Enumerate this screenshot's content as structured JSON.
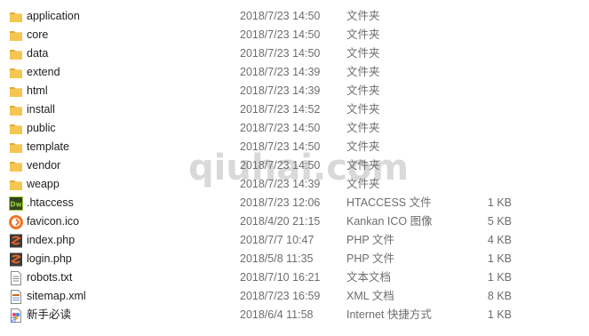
{
  "files": [
    {
      "name": "application",
      "date": "2018/7/23 14:50",
      "type": "文件夹",
      "size": "",
      "icon": "folder-icon"
    },
    {
      "name": "core",
      "date": "2018/7/23 14:50",
      "type": "文件夹",
      "size": "",
      "icon": "folder-icon"
    },
    {
      "name": "data",
      "date": "2018/7/23 14:50",
      "type": "文件夹",
      "size": "",
      "icon": "folder-icon"
    },
    {
      "name": "extend",
      "date": "2018/7/23 14:39",
      "type": "文件夹",
      "size": "",
      "icon": "folder-icon"
    },
    {
      "name": "html",
      "date": "2018/7/23 14:39",
      "type": "文件夹",
      "size": "",
      "icon": "folder-icon"
    },
    {
      "name": "install",
      "date": "2018/7/23 14:52",
      "type": "文件夹",
      "size": "",
      "icon": "folder-icon"
    },
    {
      "name": "public",
      "date": "2018/7/23 14:50",
      "type": "文件夹",
      "size": "",
      "icon": "folder-icon"
    },
    {
      "name": "template",
      "date": "2018/7/23 14:50",
      "type": "文件夹",
      "size": "",
      "icon": "folder-icon"
    },
    {
      "name": "vendor",
      "date": "2018/7/23 14:50",
      "type": "文件夹",
      "size": "",
      "icon": "folder-icon"
    },
    {
      "name": "weapp",
      "date": "2018/7/23 14:39",
      "type": "文件夹",
      "size": "",
      "icon": "folder-icon"
    },
    {
      "name": ".htaccess",
      "date": "2018/7/23 12:06",
      "type": "HTACCESS 文件",
      "size": "1 KB",
      "icon": "dreamweaver-file-icon"
    },
    {
      "name": "favicon.ico",
      "date": "2018/4/20 21:15",
      "type": "Kankan ICO 图像",
      "size": "5 KB",
      "icon": "ico-image-icon"
    },
    {
      "name": "index.php",
      "date": "2018/7/7 10:47",
      "type": "PHP 文件",
      "size": "4 KB",
      "icon": "php-file-icon"
    },
    {
      "name": "login.php",
      "date": "2018/5/8 11:35",
      "type": "PHP 文件",
      "size": "1 KB",
      "icon": "php-file-icon"
    },
    {
      "name": "robots.txt",
      "date": "2018/7/10 16:21",
      "type": "文本文档",
      "size": "1 KB",
      "icon": "text-file-icon"
    },
    {
      "name": "sitemap.xml",
      "date": "2018/7/23 16:59",
      "type": "XML 文档",
      "size": "8 KB",
      "icon": "xml-file-icon"
    },
    {
      "name": "新手必读",
      "date": "2018/6/4 11:58",
      "type": "Internet 快捷方式",
      "size": "1 KB",
      "icon": "internet-shortcut-icon"
    }
  ],
  "watermark": "qiuhai.com",
  "colors": {
    "folder": "#f5c650",
    "folder_dark": "#e2a93a",
    "dreamweaver": "#35421e",
    "dreamweaver_text": "#9bd13a",
    "php": "#e8652a",
    "ico": "#f07427"
  }
}
